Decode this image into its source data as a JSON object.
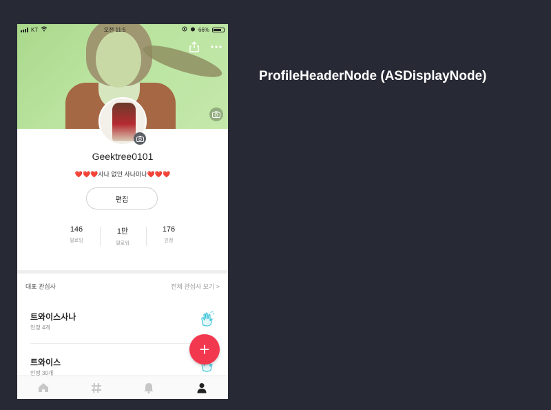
{
  "slide": {
    "title": "ProfileHeaderNode (ASDisplayNode)"
  },
  "status_bar": {
    "carrier": "KT",
    "time": "오전 11:5",
    "battery_percent": "66%"
  },
  "profile": {
    "username": "Geektree0101",
    "bio_text": "사나 없인 사나마나",
    "bio_hearts_left": "❤️❤️❤️",
    "bio_hearts_right": "❤️❤️❤️",
    "edit_label": "편집"
  },
  "stats": [
    {
      "value": "146",
      "label": "팔로잉"
    },
    {
      "value": "1만",
      "label": "팔로워"
    },
    {
      "value": "176",
      "label": "인정"
    }
  ],
  "interests": {
    "title": "대표 관심사",
    "view_all": "전체 관심사 보기 >",
    "items": [
      {
        "name": "트와이스사나",
        "sub": "인정 4개"
      },
      {
        "name": "트와이스",
        "sub": "인정 30개"
      }
    ]
  },
  "tabs": [
    {
      "icon": "home-icon"
    },
    {
      "icon": "hashtag-icon"
    },
    {
      "icon": "bell-icon"
    },
    {
      "icon": "person-icon"
    }
  ],
  "colors": {
    "background": "#272a35",
    "cover_overlay": "#b9e39e",
    "fab": "#f2384f",
    "heart": "#e0243a",
    "clap_icon": "#3cc3d9"
  }
}
